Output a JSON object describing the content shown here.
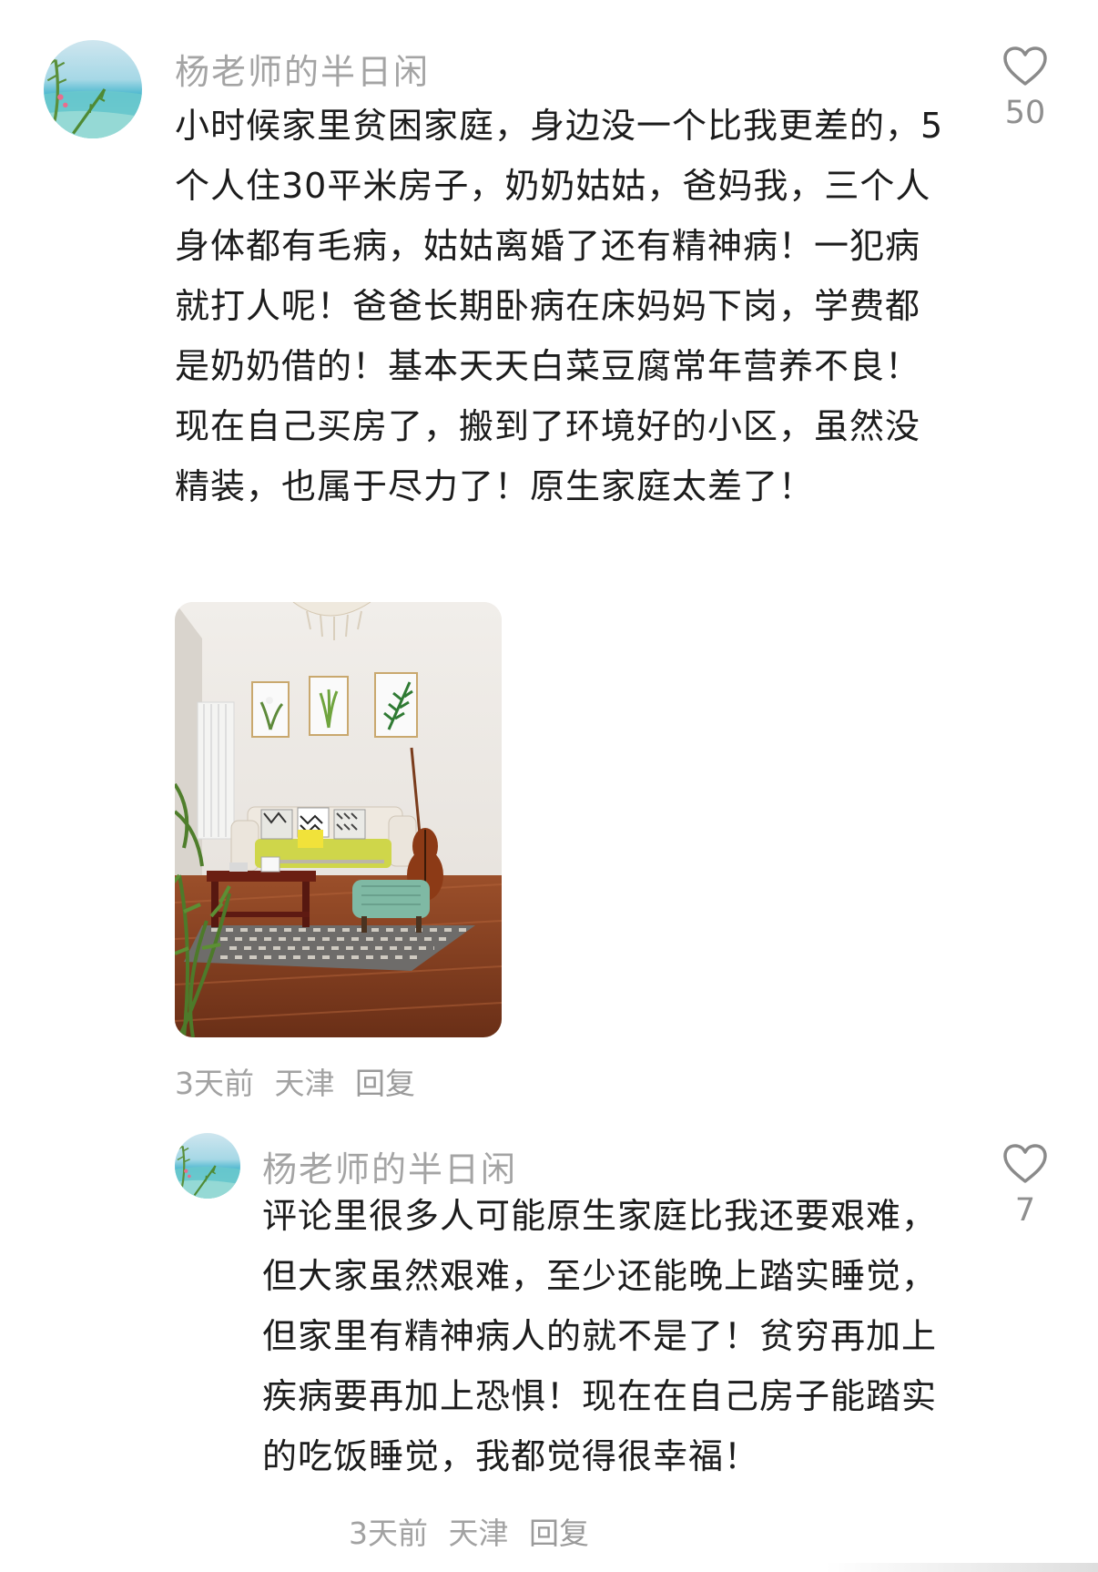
{
  "comments": [
    {
      "username": "杨老师的半日闲",
      "text": "小时候家里贫困家庭，身边没一个比我更差的，5个人住30平米房子，奶奶姑姑，爸妈我，三个人身体都有毛病，姑姑离婚了还有精神病！一犯病就打人呢！爸爸长期卧病在床妈妈下岗，学费都是奶奶借的！基本天天白菜豆腐常年营养不良！现在自己买房了，搬到了环境好的小区，虽然没精装，也属于尽力了！原生家庭太差了！",
      "time": "3天前",
      "location": "天津",
      "reply_label": "回复",
      "likes": "50"
    },
    {
      "username": "杨老师的半日闲",
      "text": "评论里很多人可能原生家庭比我还要艰难，但大家虽然艰难，至少还能晚上踏实睡觉，但家里有精神病人的就不是了！贫穷再加上疾病要再加上恐惧！现在在自己房子能踏实的吃饭睡觉，我都觉得很幸福！",
      "time": "3天前",
      "location": "天津",
      "reply_label": "回复",
      "likes": "7"
    }
  ],
  "icons": {
    "like": "heart-outline-icon",
    "avatar": "beach-avatar"
  },
  "colors": {
    "username": "#a4a4a4",
    "meta": "#a2a2a2",
    "text": "#1c1c1c",
    "like_icon": "#8a8a8a"
  }
}
